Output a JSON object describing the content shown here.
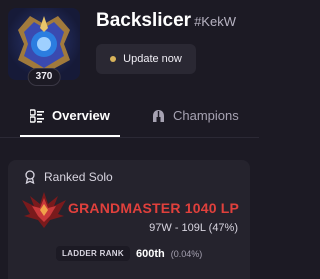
{
  "profile": {
    "summoner_name": "Backslicer",
    "tagline": "#KekW",
    "level": "370",
    "update_label": "Update now"
  },
  "tabs": [
    {
      "label": "Overview",
      "icon": "list-icon",
      "active": true
    },
    {
      "label": "Champions",
      "icon": "helmet-icon",
      "active": false
    }
  ],
  "ranked": {
    "title": "Ranked Solo",
    "title_icon": "award-icon",
    "tier": "GRANDMASTER",
    "lp": "1040 LP",
    "tier_lp": "GRANDMASTER 1040 LP",
    "record": "97W - 109L (47%)",
    "ladder_label": "LADDER RANK",
    "ladder_position": "600th",
    "ladder_percent": "(0.04%)"
  },
  "colors": {
    "background": "#1c1a24",
    "card": "#25232d",
    "tier_red": "#e0403c",
    "update_dot": "#d8b35a"
  }
}
